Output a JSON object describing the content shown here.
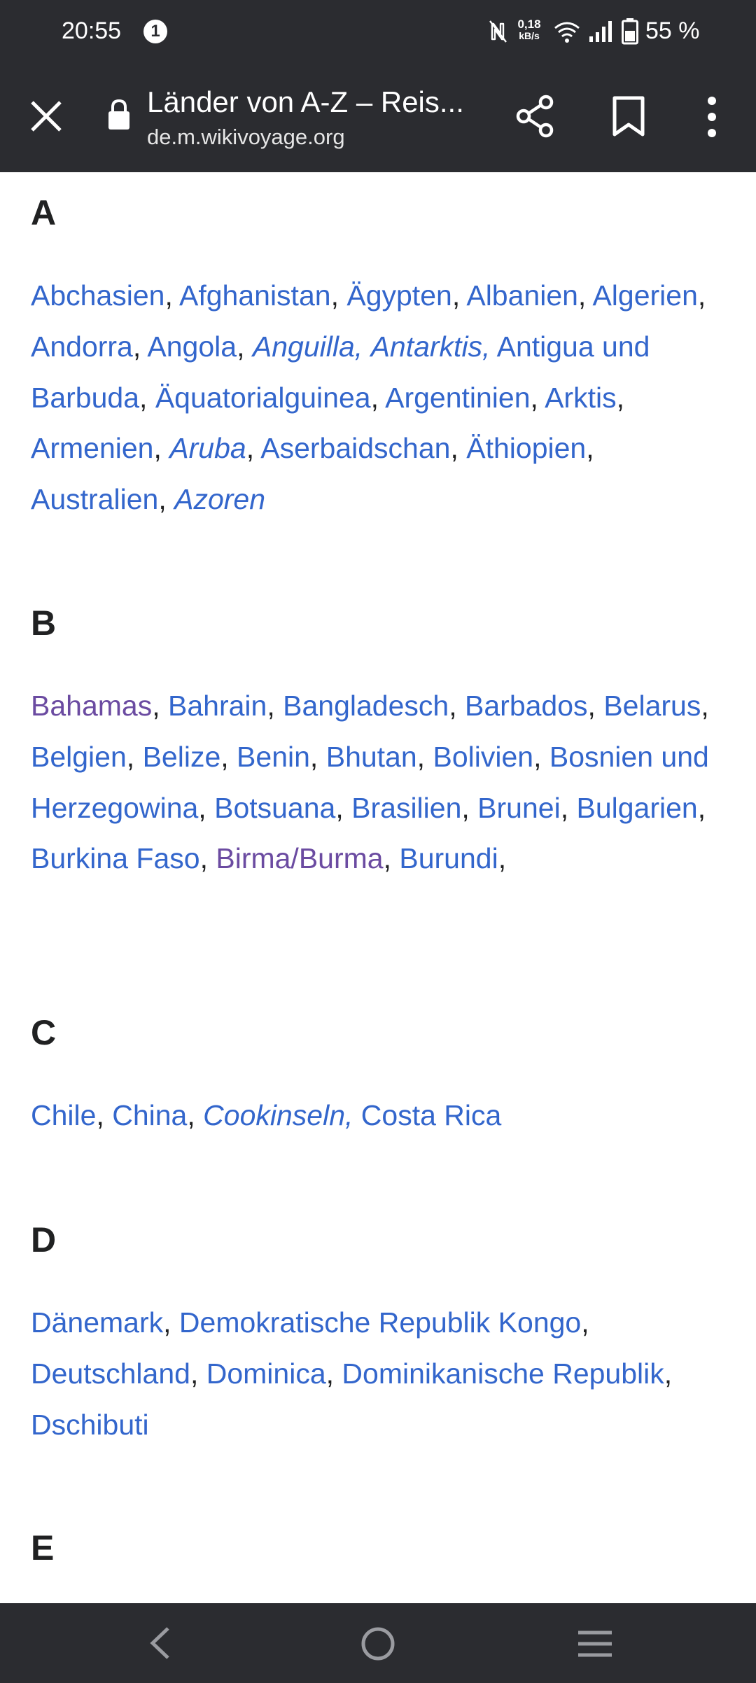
{
  "status_bar": {
    "time": "20:55",
    "notification_count": "1",
    "data_rate_value": "0,18",
    "data_rate_unit": "kB/s",
    "battery_percent": "55 %",
    "icons": [
      "nfc-icon",
      "wifi-icon",
      "signal-icon",
      "battery-icon"
    ]
  },
  "toolbar": {
    "title": "Länder von A-Z – Reis...",
    "url": "de.m.wikivoyage.org",
    "icons": [
      "close-icon",
      "lock-icon",
      "share-icon",
      "bookmark-icon",
      "more-vert-icon"
    ]
  },
  "colors": {
    "bar_background": "#2b2c30",
    "link": "#3366cc",
    "visited_link": "#6b4ba1",
    "text": "#202122"
  },
  "sections": [
    {
      "letter": "A",
      "countries": [
        {
          "name": "Abchasien",
          "sep": ", "
        },
        {
          "name": "Afghanistan",
          "sep": ", "
        },
        {
          "name": "Ägypten",
          "sep": ", "
        },
        {
          "name": "Albanien",
          "sep": ", "
        },
        {
          "name": "Algerien",
          "sep": ", "
        },
        {
          "name": "Andorra",
          "sep": ", "
        },
        {
          "name": "Angola",
          "sep": ", "
        },
        {
          "name": "Anguilla,",
          "italic": true,
          "sep": " "
        },
        {
          "name": "Antarktis,",
          "italic": true,
          "sep": " "
        },
        {
          "name": "Antigua und Barbuda",
          "sep": ", "
        },
        {
          "name": "Äquatorialguinea",
          "sep": ", "
        },
        {
          "name": "Argentinien",
          "sep": ", "
        },
        {
          "name": "Arktis",
          "sep": ", "
        },
        {
          "name": "Armenien",
          "sep": ", "
        },
        {
          "name": "Aruba",
          "italic": true,
          "sep": ", "
        },
        {
          "name": "Aserbaidschan",
          "sep": ", "
        },
        {
          "name": "Äthiopien",
          "sep": ", "
        },
        {
          "name": "Australien",
          "sep": ", "
        },
        {
          "name": "Azoren",
          "italic": true,
          "sep": ""
        }
      ]
    },
    {
      "letter": "B",
      "countries": [
        {
          "name": "Bahamas",
          "visited": true,
          "sep": ", "
        },
        {
          "name": "Bahrain",
          "sep": ", "
        },
        {
          "name": "Bangladesch",
          "sep": ", "
        },
        {
          "name": "Barbados",
          "sep": ", "
        },
        {
          "name": "Belarus",
          "sep": ", "
        },
        {
          "name": "Belgien",
          "sep": ", "
        },
        {
          "name": "Belize",
          "sep": ", "
        },
        {
          "name": "Benin",
          "sep": ", "
        },
        {
          "name": "Bhutan",
          "sep": ", "
        },
        {
          "name": "Bolivien",
          "sep": ", "
        },
        {
          "name": "Bosnien und Herzegowina",
          "sep": ", "
        },
        {
          "name": "Botsuana",
          "sep": ", "
        },
        {
          "name": "Brasilien",
          "sep": ", "
        },
        {
          "name": "Brunei",
          "sep": ", "
        },
        {
          "name": "Bulgarien",
          "sep": ", "
        },
        {
          "name": "Burkina Faso",
          "sep": ", "
        },
        {
          "name": "Birma/Burma",
          "visited": true,
          "sep": ", "
        },
        {
          "name": "Burundi",
          "sep": ","
        }
      ]
    },
    {
      "letter": "C",
      "countries": [
        {
          "name": "Chile",
          "sep": ", "
        },
        {
          "name": "China",
          "sep": ", "
        },
        {
          "name": "Cookinseln,",
          "italic": true,
          "sep": " "
        },
        {
          "name": "Costa Rica",
          "sep": ""
        }
      ]
    },
    {
      "letter": "D",
      "countries": [
        {
          "name": "Dänemark",
          "sep": ", "
        },
        {
          "name": "Demokratische Republik Kongo",
          "sep": ", "
        },
        {
          "name": "Deutschland",
          "sep": ", "
        },
        {
          "name": "Dominica",
          "sep": ", "
        },
        {
          "name": "Dominikanische Republik",
          "sep": ", "
        },
        {
          "name": "Dschibuti",
          "sep": ""
        }
      ]
    },
    {
      "letter": "E",
      "countries": []
    }
  ],
  "nav_bar": {
    "icons": [
      "back-icon",
      "home-icon",
      "recent-apps-icon"
    ]
  }
}
